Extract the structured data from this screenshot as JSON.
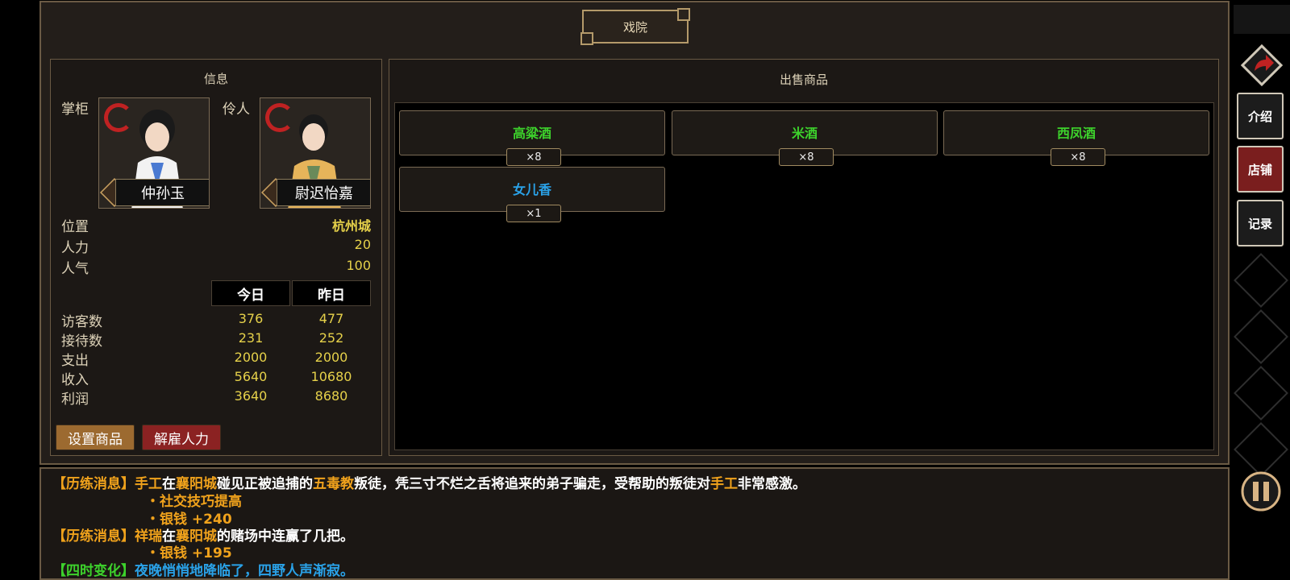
{
  "title": "戏院",
  "info": {
    "heading": "信息",
    "manager_label": "掌柜",
    "actor_label": "伶人",
    "manager_name": "仲孙玉",
    "actor_name": "尉迟怡嘉",
    "stats": [
      {
        "label": "位置",
        "value": "杭州城"
      },
      {
        "label": "人力",
        "value": "20"
      },
      {
        "label": "人气",
        "value": "100"
      }
    ],
    "col_today": "今日",
    "col_yesterday": "昨日",
    "rows": [
      {
        "label": "访客数",
        "today": "376",
        "yesterday": "477"
      },
      {
        "label": "接待数",
        "today": "231",
        "yesterday": "252"
      },
      {
        "label": "支出",
        "today": "2000",
        "yesterday": "2000"
      },
      {
        "label": "收入",
        "today": "5640",
        "yesterday": "10680"
      },
      {
        "label": "利润",
        "today": "3640",
        "yesterday": "8680"
      }
    ],
    "btn_set_goods": "设置商品",
    "btn_fire": "解雇人力"
  },
  "goods": {
    "heading": "出售商品",
    "items": [
      {
        "name": "高粱酒",
        "qty": "×8",
        "color": "#3dd22c"
      },
      {
        "name": "米酒",
        "qty": "×8",
        "color": "#3dd22c"
      },
      {
        "name": "西凤酒",
        "qty": "×8",
        "color": "#3dd22c"
      },
      {
        "name": "女儿香",
        "qty": "×1",
        "color": "#2aa2e8"
      }
    ]
  },
  "log": {
    "l1": [
      "【历练消息】",
      "手工",
      "在",
      "襄阳城",
      "碰见正被追捕的",
      "五毒教",
      "叛徒，凭三寸不烂之舌将追来的弟子骗走，受帮助的叛徒对",
      "手工",
      "非常感激。"
    ],
    "l2": "・社交技巧提高",
    "l3": "・银钱 +240",
    "l4": [
      "【历练消息】",
      "祥瑞",
      "在",
      "襄阳城",
      "的赌场中连赢了几把。"
    ],
    "l5": "・银钱 +195",
    "l6": [
      "【四时变化】",
      "夜晚悄悄地降临了，四野人声渐寂。"
    ]
  },
  "sidebar": {
    "intro": "介绍",
    "shop": "店铺",
    "record": "记录"
  },
  "colors": {
    "accent_red": "#8b2222",
    "gold": "#e6d14a"
  }
}
